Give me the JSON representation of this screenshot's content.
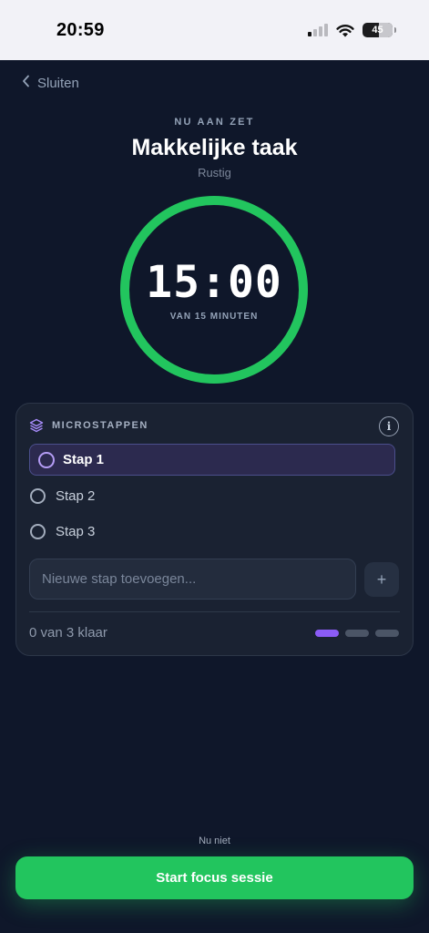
{
  "status_bar": {
    "time": "20:59",
    "battery_percent": "45",
    "battery_level": 0.45,
    "signal_bars_active": 1,
    "signal_bars_total": 4
  },
  "header": {
    "back_label": "Sluiten"
  },
  "task": {
    "kicker": "NU AAN ZET",
    "title": "Makkelijke taak",
    "subtitle": "Rustig"
  },
  "timer": {
    "display": "15:00",
    "subtitle": "VAN 15 MINUTEN",
    "remaining_fraction": 1.0,
    "ring_color": "#22c55e"
  },
  "microsteps": {
    "title": "MICROSTAPPEN",
    "info_icon": "i",
    "steps": [
      {
        "label": "Stap 1",
        "active": true,
        "done": false
      },
      {
        "label": "Stap 2",
        "active": false,
        "done": false
      },
      {
        "label": "Stap 3",
        "active": false,
        "done": false
      }
    ],
    "new_step_placeholder": "Nieuwe stap toevoegen...",
    "add_button_label": "+",
    "progress_text": "0 van 3 klaar",
    "progress_segments": 3,
    "accent_color": "#8b5cf6"
  },
  "footer": {
    "not_now_label": "Nu niet",
    "start_button_label": "Start focus sessie",
    "button_color": "#22c55e"
  }
}
